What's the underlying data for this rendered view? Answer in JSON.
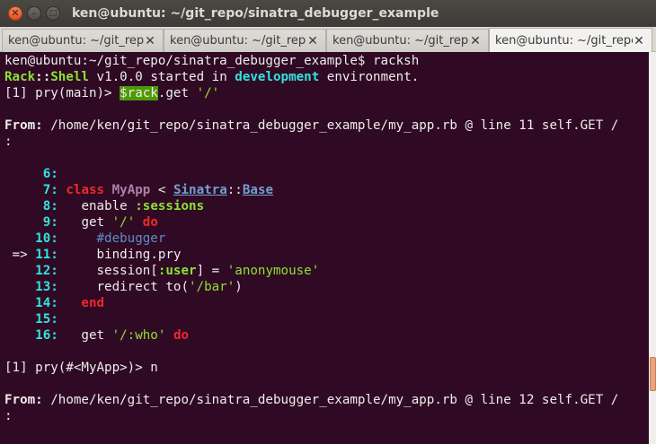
{
  "window": {
    "title": "ken@ubuntu: ~/git_repo/sinatra_debugger_example",
    "close_glyph": "✕",
    "min_glyph": "–",
    "max_glyph": "□"
  },
  "tabs": [
    {
      "label": "ken@ubuntu: ~/git_repo/sinatra",
      "close": "✕",
      "active": false
    },
    {
      "label": "ken@ubuntu: ~/git_repo/sinatra",
      "close": "✕",
      "active": false
    },
    {
      "label": "ken@ubuntu: ~/git_repo/sinatra",
      "close": "✕",
      "active": false
    },
    {
      "label": "ken@ubuntu: ~/git_repo/sinatra",
      "close": "✕",
      "active": true
    }
  ],
  "terminal": {
    "l1": "ken@ubuntu:~/git_repo/sinatra_debugger_example$ racksh",
    "l2": {
      "a": "Rack",
      "b": "::",
      "c": "Shell",
      "d": " v1.0.0 started in ",
      "e": "development",
      "f": " environment."
    },
    "l3": {
      "a": "[1] pry(main)> ",
      "b": "$rack",
      "c": ".get ",
      "d": "'/'"
    },
    "l5": {
      "a": "From:",
      "b": " /home/ken/git_repo/sinatra_debugger_example/my_app.rb @ line 11 self.GET /"
    },
    "l6": ":",
    "code": {
      "n6": "6:",
      "n7": "7:",
      "c7a": "class",
      "c7b": "MyApp",
      "c7c": " < ",
      "c7d": "Sinatra",
      "c7e": "::",
      "c7f": "Base",
      "n8": "8:",
      "c8a": "  enable ",
      "c8b": ":sessions",
      "n9": "9:",
      "c9a": "  get ",
      "c9b": "'/'",
      "c9c": "do",
      "n10": "10:",
      "c10": "    #debugger",
      "arrow": "=>",
      "n11": "11:",
      "c11": "    binding.pry",
      "n12": "12:",
      "c12a": "    session[",
      "c12b": ":user",
      "c12c": "] = ",
      "c12d": "'anonymouse'",
      "n13": "13:",
      "c13a": "    redirect to(",
      "c13b": "'/bar'",
      "c13c": ")",
      "n14": "14:",
      "c14": "  end",
      "n15": "15:",
      "n16": "16:",
      "c16a": "  get ",
      "c16b": "'/:who'",
      "c16c": "do"
    },
    "l20": "[1] pry(#<MyApp>)> n",
    "l22": {
      "a": "From:",
      "b": " /home/ken/git_repo/sinatra_debugger_example/my_app.rb @ line 12 self.GET /"
    },
    "l23": ":"
  }
}
